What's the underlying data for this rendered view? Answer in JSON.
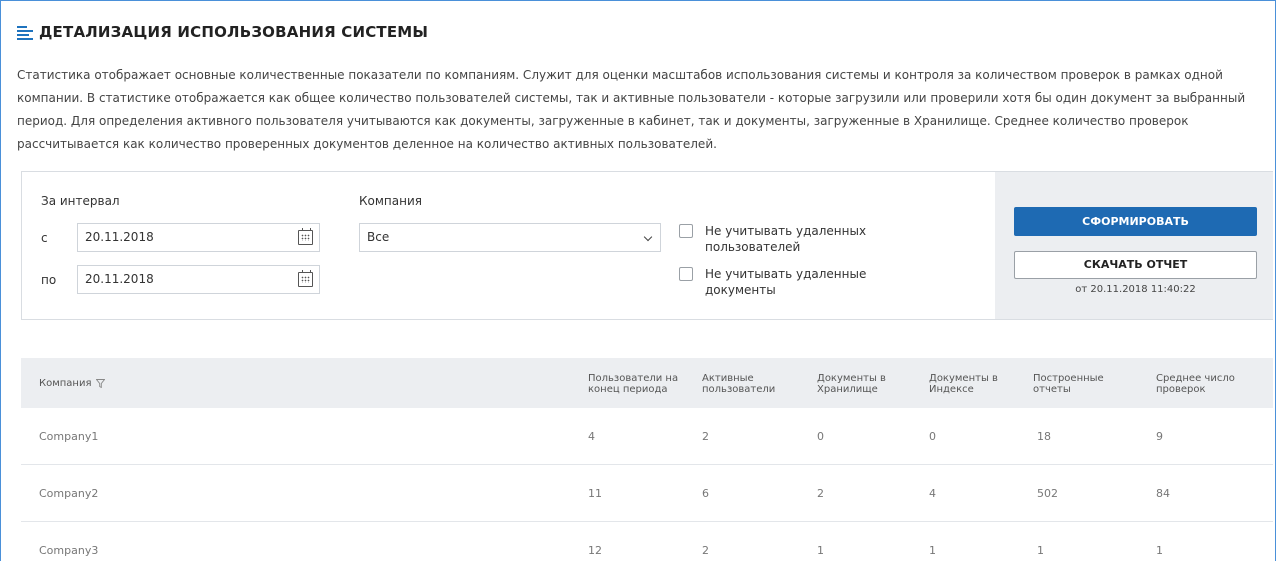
{
  "page": {
    "title": "ДЕТАЛИЗАЦИЯ ИСПОЛЬЗОВАНИЯ СИСТЕМЫ",
    "description_lines": [
      "Статистика отображает основные количественные показатели по компаниям. Служит для оценки масштабов использования системы и контроля за количеством проверок в рамках одной",
      "компании. В статистике отображается как общее количество пользователей системы, так и активные пользователи - которые загрузили или проверили хотя бы один документ за выбранный",
      "период. Для определения активного пользователя учитываются как документы, загруженные в кабинет, так и документы, загруженные в Хранилище. Среднее количество проверок",
      "рассчитывается как количество проверенных документов деленное на количество активных пользователей."
    ]
  },
  "filters": {
    "interval_label": "За интервал",
    "from_label": "с",
    "from_value": "20.11.2018",
    "to_label": "по",
    "to_value": "20.11.2018",
    "company_label": "Компания",
    "company_value": "Все",
    "exclude_deleted_users_lines": [
      "Не учитывать удаленных",
      "пользователей"
    ],
    "exclude_deleted_docs_lines": [
      "Не учитывать удаленные",
      "документы"
    ],
    "generate_button": "СФОРМИРОВАТЬ",
    "download_button": "СКАЧАТЬ ОТЧЕТ",
    "report_date": "от 20.11.2018 11:40:22"
  },
  "table": {
    "columns": [
      [
        "Компания"
      ],
      [
        "Пользователи на",
        "конец периода"
      ],
      [
        "Активные",
        "пользователи"
      ],
      [
        "Документы в",
        "Хранилище"
      ],
      [
        "Документы в",
        "Индексе"
      ],
      [
        "Построенные",
        "отчеты"
      ],
      [
        "Среднее число",
        "проверок"
      ]
    ],
    "rows": [
      [
        "Company1",
        "4",
        "2",
        "0",
        "0",
        "18",
        "9"
      ],
      [
        "Company2",
        "11",
        "6",
        "2",
        "4",
        "502",
        "84"
      ],
      [
        "Company3",
        "12",
        "2",
        "1",
        "1",
        "1",
        "1"
      ]
    ]
  },
  "colors": {
    "accent": "#1e6ab3",
    "header_bg": "#eceef1"
  }
}
